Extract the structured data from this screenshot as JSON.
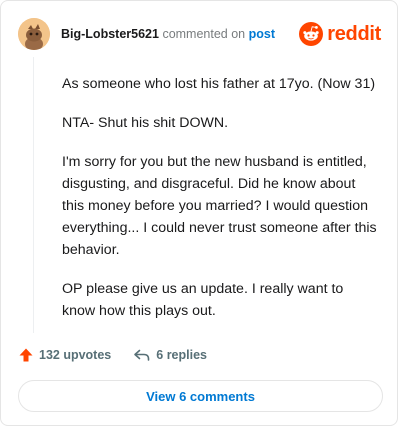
{
  "header": {
    "username": "Big-Lobster5621",
    "commented_text": "commented on",
    "post_link": "post",
    "brand_name": "reddit",
    "brand_color": "#ff4500",
    "avatar_icon": "snoo-avatar-icon"
  },
  "comment": {
    "paragraphs": [
      "As someone who lost his father at 17yo. (Now 31)",
      "NTA- Shut his shit DOWN.",
      "I'm sorry for you but the new husband is entitled, disgusting, and disgraceful. Did he know about this money before you married? I would question everything... I could never trust someone after this behavior.",
      "OP please give us an update. I really want to know how this plays out."
    ]
  },
  "actions": {
    "upvotes": "132 upvotes",
    "replies": "6 replies",
    "upvote_icon": "upvote-arrow-icon",
    "reply_icon": "reply-arrow-icon"
  },
  "footer": {
    "view_comments": "View 6 comments"
  },
  "colors": {
    "link_blue": "#0079d3",
    "upvote_orange": "#ff4500",
    "muted_gray": "#787c7e"
  }
}
